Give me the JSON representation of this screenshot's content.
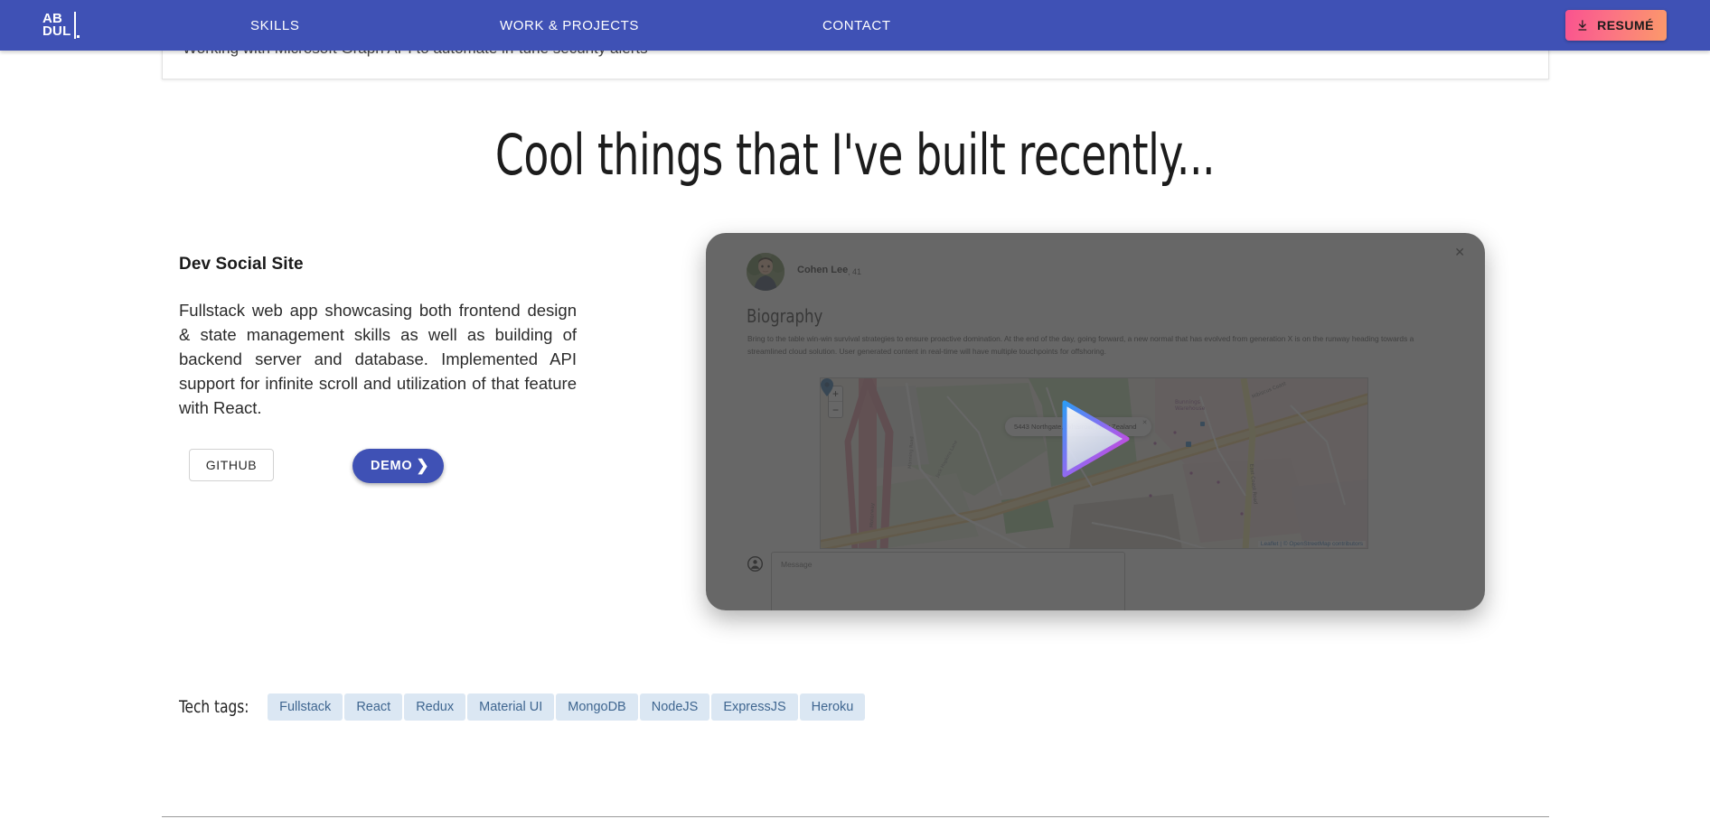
{
  "navbar": {
    "logo": {
      "line1": "AB",
      "line2": "DUL",
      "name": "abdul-logo"
    },
    "links": [
      {
        "label": "SKILLS",
        "name": "nav-link-skills"
      },
      {
        "label": "WORK & PROJECTS",
        "name": "nav-link-work-projects"
      },
      {
        "label": "CONTACT",
        "name": "nav-link-contact"
      }
    ],
    "resume_button": {
      "label": "RESUMÉ",
      "icon": "download-icon",
      "gradient_from": "#f9538f",
      "gradient_to": "#fb9a6a"
    },
    "background_color": "#3f51b5"
  },
  "previous_section": {
    "bullet": "Working with Microsoft Graph API to automate in-tune security alerts"
  },
  "section": {
    "heading": "Cool things that I've built recently..."
  },
  "project": {
    "title": "Dev Social Site",
    "description": "Fullstack web app showcasing both frontend design & state management skills as well as building of backend server and database. Implemented API support for infinite scroll and utilization of that feature with React.",
    "github_button": "GITHUB",
    "demo_button": "DEMO",
    "demo_chevron": "❯",
    "tech_tags_label": "Tech tags:",
    "tech_tags": [
      "Fullstack",
      "React",
      "Redux",
      "Material UI",
      "MongoDB",
      "NodeJS",
      "ExpressJS",
      "Heroku"
    ],
    "accent_color": "#3f51b5",
    "tag_background": "#dbe7f3",
    "tag_color": "#3f6690"
  },
  "demo_preview": {
    "profile_name": "Cohen Lee",
    "profile_age": ", 41",
    "close_icon": "✕",
    "bio_heading": "Biography",
    "bio_text": "Bring to the table win-win survival strategies to ensure proactive domination. At the end of the day, going forward, a new normal that has evolved from generation X is on the runway heading towards a streamlined cloud solution. User generated content in real-time will have multiple touchpoints for offshoring.",
    "map": {
      "zoom_in": "+",
      "zoom_out": "−",
      "popup_text": "5443 Northgate, Wharrow, New Zealand",
      "popup_close": "✕",
      "attribution": "Leaflet | © OpenStreetMap contributors",
      "labels": [
        "Motorway",
        "East Coast Road",
        "Bunnings Warehouse",
        "Silverdale",
        "Hibiscus Coast"
      ]
    },
    "message_placeholder": "Message",
    "person_icon": "account-circle-icon",
    "play_icon": "play-triangle-icon",
    "play_gradient_from": "#2e9bf5",
    "play_gradient_to": "#d63af0"
  }
}
